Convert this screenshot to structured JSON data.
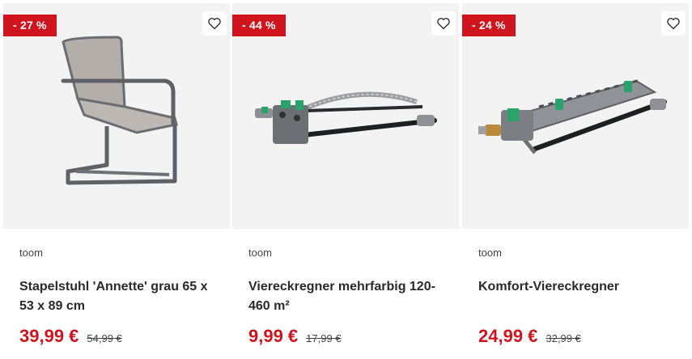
{
  "products": [
    {
      "discount": "- 27 %",
      "brand": "toom",
      "title": "Stapelstuhl 'Annette' grau 65 x 53 x 89 cm",
      "price": "39,99 €",
      "old_price": "54,99 €",
      "image_icon": "chair-image"
    },
    {
      "discount": "- 44 %",
      "brand": "toom",
      "title": "Viereckregner mehrfarbig 120-460 m²",
      "price": "9,99 €",
      "old_price": "17,99 €",
      "image_icon": "sprinkler-image"
    },
    {
      "discount": "- 24 %",
      "brand": "toom",
      "title": "Komfort-Viereckregner",
      "price": "24,99 €",
      "old_price": "32,99 €",
      "image_icon": "comfort-sprinkler-image"
    }
  ],
  "colors": {
    "badge": "#d0141e",
    "price": "#d0141e",
    "image_bg": "#f3f3f3"
  },
  "icons": {
    "wishlist": "heart-outline-icon"
  }
}
